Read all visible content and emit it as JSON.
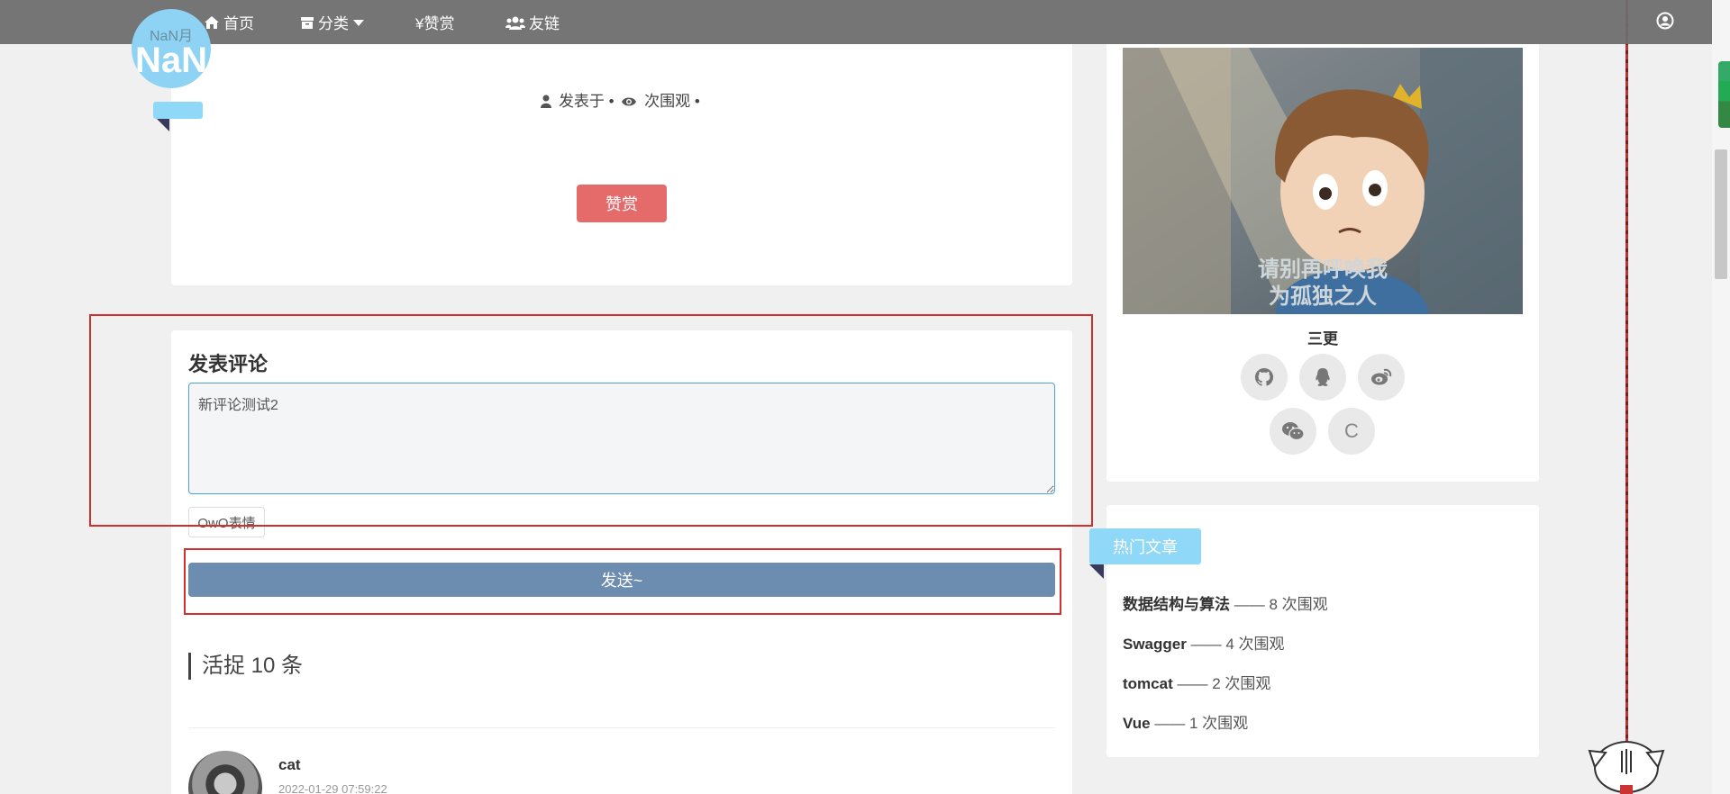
{
  "nav": {
    "home": "首页",
    "category": "分类",
    "reward": "¥赞赏",
    "friends": "友链"
  },
  "logo": {
    "small": "NaN月",
    "big": "NaN"
  },
  "post": {
    "meta_posted": "发表于 •",
    "meta_views": "次围观 •",
    "reward_button": "赞赏"
  },
  "comment_form": {
    "title": "发表评论",
    "textarea_value": "新评论测试2",
    "owo_button": "OwO表情",
    "send_button": "发送~"
  },
  "comments": {
    "count_title": "活捉 10 条",
    "items": [
      {
        "user": "cat",
        "time": "2022-01-29 07:59:22"
      }
    ]
  },
  "profile": {
    "image_caption_line1": "请别再呼唤我",
    "image_caption_line2": "为孤独之人",
    "name": "三更",
    "social_icons": [
      "github-icon",
      "qq-icon",
      "weibo-icon",
      "wechat-icon",
      "csdn-icon"
    ],
    "csdn_label": "C"
  },
  "hot": {
    "tag": "热门文章",
    "items": [
      {
        "title": "数据结构与算法",
        "suffix": "—— 8 次围观"
      },
      {
        "title": "Swagger",
        "suffix": "—— 4 次围观"
      },
      {
        "title": "tomcat",
        "suffix": "—— 2 次围观"
      },
      {
        "title": "Vue",
        "suffix": "—— 1 次围观"
      }
    ]
  },
  "colors": {
    "nav_bg": "#6e6e6e",
    "accent_blue": "#8fd8f8",
    "reward_red": "#e56a6a",
    "send_blue": "#6c8cb0",
    "highlight_red": "#d32f2f"
  }
}
